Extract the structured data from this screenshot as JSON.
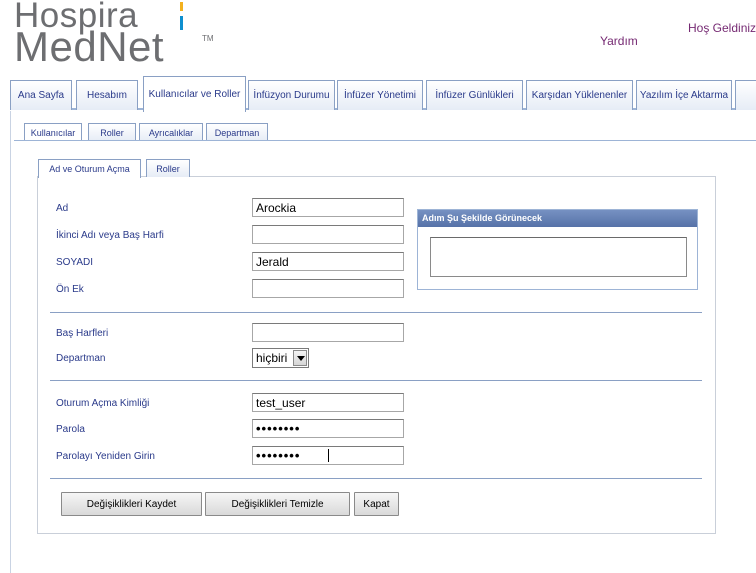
{
  "header": {
    "logo_line1": "Hospira",
    "logo_line2": "MedNet",
    "logo_tm": "TM",
    "help_label": "Yardım",
    "welcome_text": "Hoş Geldiniz!"
  },
  "main_tabs": [
    {
      "label": "Ana Sayfa",
      "active": false
    },
    {
      "label": "Hesabım",
      "active": false
    },
    {
      "label": "Kullanıcılar ve Roller",
      "active": true
    },
    {
      "label": "İnfüzyon Durumu",
      "active": false
    },
    {
      "label": "İnfüzer Yönetimi",
      "active": false
    },
    {
      "label": "İnfüzer Günlükleri",
      "active": false
    },
    {
      "label": "Karşıdan Yüklenenler",
      "active": false
    },
    {
      "label": "Yazılım İçe Aktarma",
      "active": false
    }
  ],
  "sub_tabs": [
    {
      "label": "Kullanıcılar",
      "active": true
    },
    {
      "label": "Roller",
      "active": false
    },
    {
      "label": "Ayrıcalıklar",
      "active": false
    },
    {
      "label": "Departman",
      "active": false
    }
  ],
  "inner_tabs": [
    {
      "label": "Ad ve Oturum Açma",
      "active": true
    },
    {
      "label": "Roller",
      "active": false
    }
  ],
  "form": {
    "first_name_label": "Ad",
    "first_name_value": "Arockia",
    "middle_name_label": "İkinci Adı veya Baş Harfi",
    "middle_name_value": "",
    "last_name_label": "SOYADI",
    "last_name_value": "Jerald",
    "prefix_label": "Ön Ek",
    "prefix_value": "",
    "initials_label": "Baş Harfleri",
    "initials_value": "",
    "department_label": "Departman",
    "department_value": "hiçbiri",
    "login_id_label": "Oturum Açma Kimliği",
    "login_id_value": "test_user",
    "password_label": "Parola",
    "password_value": "••••••••",
    "password_confirm_label": "Parolayı Yeniden Girin",
    "password_confirm_value": "••••••••"
  },
  "preview": {
    "title": "Adım Şu Şekilde Görünecek",
    "value": ""
  },
  "buttons": {
    "save": "Değişiklikleri Kaydet",
    "clear": "Değişiklikleri Temizle",
    "close": "Kapat"
  },
  "colors": {
    "brand_purple": "#762a73",
    "tab_text": "#2a3a8a",
    "preview_header": "#5672a8",
    "logo_yellow": "#f3b11e",
    "logo_blue": "#0e8fcf"
  }
}
